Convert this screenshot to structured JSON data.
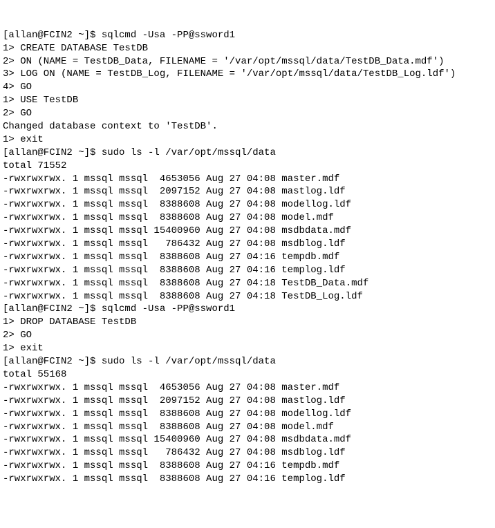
{
  "lines": [
    "[allan@FCIN2 ~]$ sqlcmd -Usa -PP@ssword1",
    "1> CREATE DATABASE TestDB",
    "2> ON (NAME = TestDB_Data, FILENAME = '/var/opt/mssql/data/TestDB_Data.mdf')",
    "3> LOG ON (NAME = TestDB_Log, FILENAME = '/var/opt/mssql/data/TestDB_Log.ldf')",
    "4> GO",
    "1> USE TestDB",
    "2> GO",
    "Changed database context to 'TestDB'.",
    "1> exit",
    "[allan@FCIN2 ~]$ sudo ls -l /var/opt/mssql/data",
    "total 71552",
    "-rwxrwxrwx. 1 mssql mssql  4653056 Aug 27 04:08 master.mdf",
    "-rwxrwxrwx. 1 mssql mssql  2097152 Aug 27 04:08 mastlog.ldf",
    "-rwxrwxrwx. 1 mssql mssql  8388608 Aug 27 04:08 modellog.ldf",
    "-rwxrwxrwx. 1 mssql mssql  8388608 Aug 27 04:08 model.mdf",
    "-rwxrwxrwx. 1 mssql mssql 15400960 Aug 27 04:08 msdbdata.mdf",
    "-rwxrwxrwx. 1 mssql mssql   786432 Aug 27 04:08 msdblog.ldf",
    "-rwxrwxrwx. 1 mssql mssql  8388608 Aug 27 04:16 tempdb.mdf",
    "-rwxrwxrwx. 1 mssql mssql  8388608 Aug 27 04:16 templog.ldf",
    "-rwxrwxrwx. 1 mssql mssql  8388608 Aug 27 04:18 TestDB_Data.mdf",
    "-rwxrwxrwx. 1 mssql mssql  8388608 Aug 27 04:18 TestDB_Log.ldf",
    "[allan@FCIN2 ~]$ sqlcmd -Usa -PP@ssword1",
    "1> DROP DATABASE TestDB",
    "2> GO",
    "1> exit",
    "[allan@FCIN2 ~]$ sudo ls -l /var/opt/mssql/data",
    "total 55168",
    "-rwxrwxrwx. 1 mssql mssql  4653056 Aug 27 04:08 master.mdf",
    "-rwxrwxrwx. 1 mssql mssql  2097152 Aug 27 04:08 mastlog.ldf",
    "-rwxrwxrwx. 1 mssql mssql  8388608 Aug 27 04:08 modellog.ldf",
    "-rwxrwxrwx. 1 mssql mssql  8388608 Aug 27 04:08 model.mdf",
    "-rwxrwxrwx. 1 mssql mssql 15400960 Aug 27 04:08 msdbdata.mdf",
    "-rwxrwxrwx. 1 mssql mssql   786432 Aug 27 04:08 msdblog.ldf",
    "-rwxrwxrwx. 1 mssql mssql  8388608 Aug 27 04:16 tempdb.mdf",
    "-rwxrwxrwx. 1 mssql mssql  8388608 Aug 27 04:16 templog.ldf"
  ]
}
